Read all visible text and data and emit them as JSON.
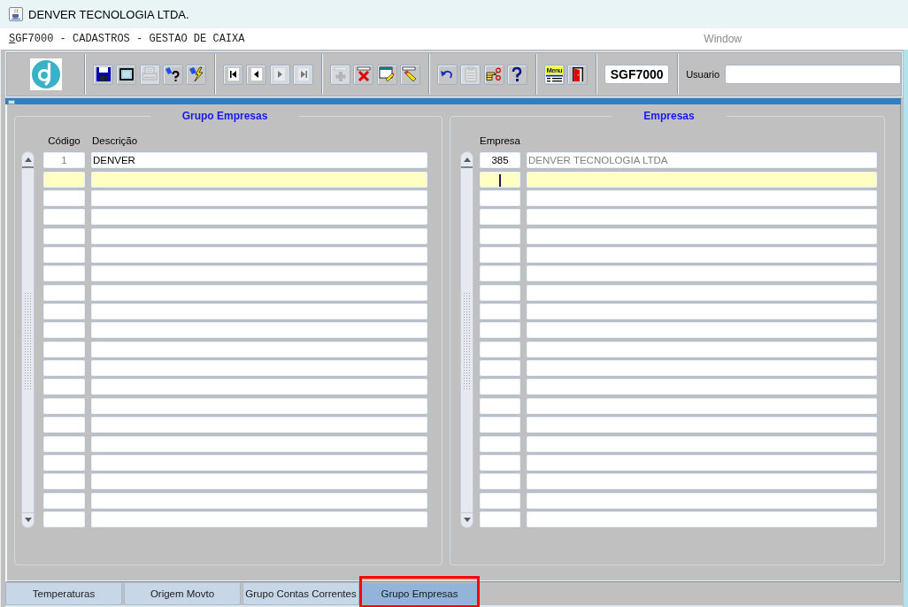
{
  "window": {
    "title": "DENVER TECNOLOGIA LTDA."
  },
  "form_bar": {
    "title": "SGF7000 - CADASTROS - GESTAO DE CAIXA",
    "menu": "Window"
  },
  "toolbar": {
    "groups": [
      [
        {
          "kind": "save",
          "disabled": false
        },
        {
          "kind": "screen",
          "disabled": false
        },
        {
          "kind": "print",
          "disabled": true
        },
        {
          "kind": "query",
          "disabled": false
        },
        {
          "kind": "execute",
          "disabled": false
        }
      ],
      [
        {
          "kind": "first",
          "disabled": false
        },
        {
          "kind": "previous",
          "disabled": false
        },
        {
          "kind": "next",
          "disabled": true
        },
        {
          "kind": "last",
          "disabled": true
        }
      ],
      [
        {
          "kind": "insert",
          "disabled": true
        },
        {
          "kind": "delete",
          "disabled": false
        },
        {
          "kind": "edit",
          "disabled": false
        },
        {
          "kind": "clear",
          "disabled": false
        }
      ],
      [
        {
          "kind": "undo",
          "disabled": false
        },
        {
          "kind": "paste",
          "disabled": true
        },
        {
          "kind": "cut",
          "disabled": false
        },
        {
          "kind": "help",
          "disabled": false
        }
      ],
      [
        {
          "kind": "menu",
          "label": "Menu",
          "disabled": false
        },
        {
          "kind": "exit",
          "disabled": false
        }
      ]
    ],
    "form_code": "SGF7000",
    "user": {
      "label": "Usuario"
    }
  },
  "panels": [
    {
      "title": "Grupo Empresas",
      "columns": [
        {
          "label": "Código",
          "readonly": true
        },
        {
          "label": "Descrição",
          "readonly": false
        }
      ],
      "rows": [
        {
          "values": [
            "1",
            "DENVER"
          ],
          "selected": false
        },
        {
          "selected": true
        },
        {
          "selected": false
        },
        {
          "selected": false
        },
        {
          "selected": false
        },
        {
          "selected": false
        },
        {
          "selected": false
        },
        {
          "selected": false
        },
        {
          "selected": false
        },
        {
          "selected": false
        },
        {
          "selected": false
        },
        {
          "selected": false
        },
        {
          "selected": false
        },
        {
          "selected": false
        },
        {
          "selected": false
        },
        {
          "selected": false
        },
        {
          "selected": false
        },
        {
          "selected": false
        },
        {
          "selected": false
        },
        {
          "selected": false
        }
      ]
    },
    {
      "title": "Empresas",
      "columns": [
        {
          "label": "Empresa",
          "readonly": false
        },
        {
          "readonly": true
        }
      ],
      "rows": [
        {
          "values": [
            "385",
            "DENVER TECNOLOGIA LTDA"
          ],
          "selected": false,
          "caret": false
        },
        {
          "selected": true,
          "caret": true
        },
        {
          "selected": false,
          "caret": false
        },
        {
          "selected": false,
          "caret": false
        },
        {
          "selected": false,
          "caret": false
        },
        {
          "selected": false,
          "caret": false
        },
        {
          "selected": false,
          "caret": false
        },
        {
          "selected": false,
          "caret": false
        },
        {
          "selected": false,
          "caret": false
        },
        {
          "selected": false,
          "caret": false
        },
        {
          "selected": false,
          "caret": false
        },
        {
          "selected": false,
          "caret": false
        },
        {
          "selected": false,
          "caret": false
        },
        {
          "selected": false,
          "caret": false
        },
        {
          "selected": false,
          "caret": false
        },
        {
          "selected": false,
          "caret": false
        },
        {
          "selected": false,
          "caret": false
        },
        {
          "selected": false,
          "caret": false
        },
        {
          "selected": false,
          "caret": false
        },
        {
          "selected": false,
          "caret": false
        }
      ]
    }
  ],
  "tabs": [
    {
      "label": "Temperaturas",
      "selected": false,
      "highlighted": false
    },
    {
      "label": "Origem Movto",
      "selected": false,
      "highlighted": false
    },
    {
      "label": "Grupo Contas Correntes",
      "selected": false,
      "highlighted": false
    },
    {
      "label": "Grupo Empresas",
      "selected": true,
      "highlighted": true
    }
  ]
}
